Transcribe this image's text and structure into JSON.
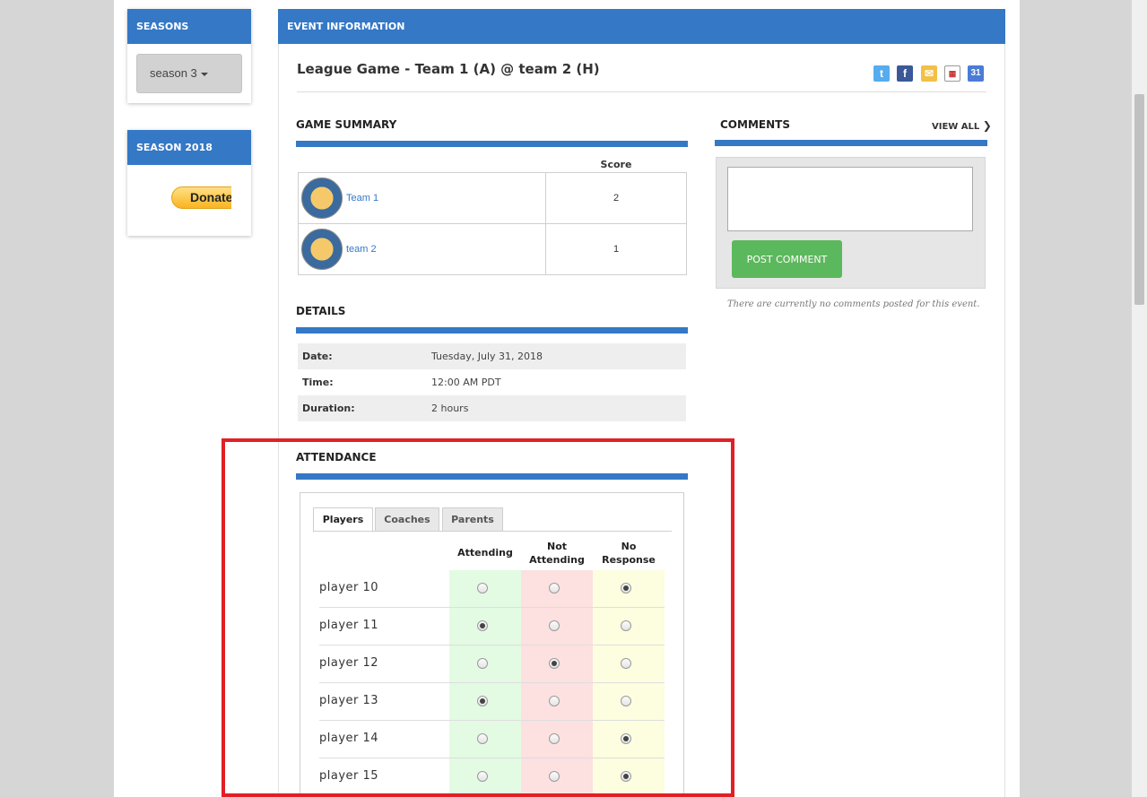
{
  "sidebar": {
    "seasons_heading": "SEASONS",
    "season_selector": "season 3",
    "season2018_heading": "SEASON 2018",
    "donate_label": "Donate"
  },
  "event": {
    "header": "EVENT INFORMATION",
    "title": "League Game - Team 1 (A) @ team 2 (H)",
    "share_icons": [
      "twitter-icon",
      "facebook-icon",
      "outlook-calendar-icon",
      "ical-icon",
      "google-calendar-icon"
    ]
  },
  "game_summary": {
    "heading": "GAME SUMMARY",
    "score_header": "Score",
    "teams": [
      {
        "name": "Team 1",
        "score": "2"
      },
      {
        "name": "team 2",
        "score": "1"
      }
    ]
  },
  "details": {
    "heading": "DETAILS",
    "rows": [
      {
        "label": "Date:",
        "value": "Tuesday, July 31, 2018"
      },
      {
        "label": "Time:",
        "value": "12:00 AM PDT"
      },
      {
        "label": "Duration:",
        "value": "2 hours"
      }
    ]
  },
  "comments": {
    "heading": "COMMENTS",
    "view_all": "VIEW ALL",
    "post_button": "POST COMMENT",
    "empty_text": "There are currently no comments posted for this event."
  },
  "attendance": {
    "heading": "ATTENDANCE",
    "tabs": [
      "Players",
      "Coaches",
      "Parents"
    ],
    "active_tab": "Players",
    "columns": [
      {
        "line1": "Attending",
        "line2": ""
      },
      {
        "line1": "Not",
        "line2": "Attending"
      },
      {
        "line1": "No",
        "line2": "Response"
      }
    ],
    "colors": {
      "attending": "#e3fbe3",
      "not_attending": "#fde0e0",
      "no_response": "#fdfde0"
    },
    "players": [
      {
        "name": "player 10",
        "selected": 2
      },
      {
        "name": "player 11",
        "selected": 0
      },
      {
        "name": "player 12",
        "selected": 1
      },
      {
        "name": "player 13",
        "selected": 0
      },
      {
        "name": "player 14",
        "selected": 2
      },
      {
        "name": "player 15",
        "selected": 2
      }
    ]
  }
}
